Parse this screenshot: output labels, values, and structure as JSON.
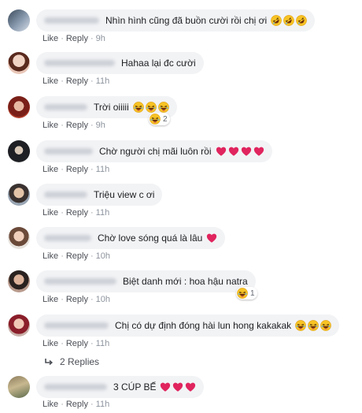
{
  "comments": [
    {
      "text": "Nhìn hình cũng đã buồn cười rồi chị ơi",
      "like": "Like",
      "reply": "Reply",
      "time": "9h"
    },
    {
      "text": "Hahaa lại đc cười",
      "like": "Like",
      "reply": "Reply",
      "time": "11h"
    },
    {
      "text": "Trời oiiiii",
      "like": "Like",
      "reply": "Reply",
      "time": "9h",
      "reaction_count": "2"
    },
    {
      "text": "Chờ người chị mãi luôn rồi",
      "like": "Like",
      "reply": "Reply",
      "time": "11h"
    },
    {
      "text": "Triệu view c ơi",
      "like": "Like",
      "reply": "Reply",
      "time": "11h"
    },
    {
      "text": "Chờ love sóng quá là lâu",
      "like": "Like",
      "reply": "Reply",
      "time": "10h"
    },
    {
      "text": "Biệt danh mới : hoa hậu natra",
      "like": "Like",
      "reply": "Reply",
      "time": "10h",
      "reaction_count": "1"
    },
    {
      "text": "Chị có dự định đóng hài lun hong kakakak",
      "like": "Like",
      "reply": "Reply",
      "time": "11h"
    },
    {
      "text": "3 CÚP BẾ",
      "like": "Like",
      "reply": "Reply",
      "time": "11h"
    }
  ],
  "replies_label": "2 Replies",
  "colors": {
    "bubble": "#f2f3f5",
    "link": "#4b4f56",
    "heart": "#e0245e",
    "emoji": "#f7b125"
  },
  "icons": [
    "rofl-emoji-icon",
    "laughing-emoji-icon",
    "heart-icon",
    "reply-arrow-icon"
  ]
}
